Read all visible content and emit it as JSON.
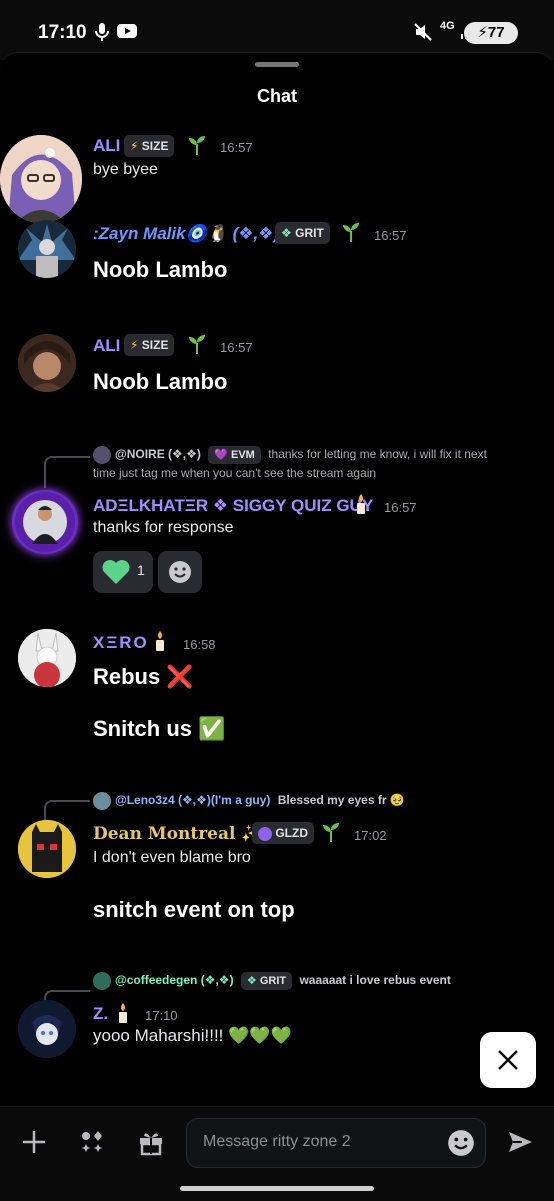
{
  "status_bar": {
    "time": "17:10",
    "network": "4G",
    "battery": "77"
  },
  "header": {
    "title": "Chat"
  },
  "messages": [
    {
      "user": "ALI",
      "badge": "SIZE",
      "time": "16:57",
      "lines": [
        "bye byee"
      ]
    },
    {
      "user": ":Zayn Malik🧿🐧 (❖,❖)",
      "badge": "GRIT",
      "time": "16:57",
      "lines": [
        "Noob Lambo"
      ]
    },
    {
      "user": "ALI",
      "badge": "SIZE",
      "time": "16:57",
      "lines": [
        "Noob Lambo"
      ]
    },
    {
      "reply_user": "@NOIRE (❖,❖)",
      "reply_badge": "EVM",
      "reply_text_1": "thanks for letting me know, i will fix it next",
      "reply_text_2": "time just tag me when you can't see the stream again",
      "user": "ADΞLKHATΞR ❖ SIGGY QUIZ GUY",
      "time": "16:57",
      "lines": [
        "thanks for response"
      ],
      "reaction_count": "1"
    },
    {
      "user": "XΞRO",
      "time": "16:58",
      "lines": [
        "Rebus ❌",
        "Snitch us ✅"
      ]
    },
    {
      "reply_user": "@Leno3z4 (❖,❖)(I'm a guy)",
      "reply_text": "Blessed my eyes fr 🥹",
      "user": "Dean Montreal ✨🧚",
      "badge": "GLZD",
      "time": "17:02",
      "lines": [
        "I don't even blame bro",
        "snitch event on top"
      ]
    },
    {
      "reply_user": "@coffeedegen (❖,❖)",
      "reply_badge": "GRIT",
      "reply_text": "waaaaat i love rebus event",
      "user": "Z.",
      "time": "17:10",
      "lines": [
        "yooo Maharshi!!!! 💚💚💚"
      ]
    }
  ],
  "composer": {
    "placeholder": "Message ritty zone 2"
  },
  "colors": {
    "name_purple": "#a58cff",
    "name_blue": "#6f97ff",
    "name_gold": "#e6c56b",
    "reply_green": "#7ff0c2",
    "heart": "#5cd38a"
  },
  "icons": [
    "mic-icon",
    "youtube-icon",
    "mute-icon",
    "signal-icon",
    "lightning-icon",
    "sprout-icon",
    "grit-icon",
    "candle-icon",
    "heart-icon",
    "emoji-icon",
    "close-icon",
    "plus-icon",
    "apps-icon",
    "gift-icon",
    "send-icon"
  ]
}
